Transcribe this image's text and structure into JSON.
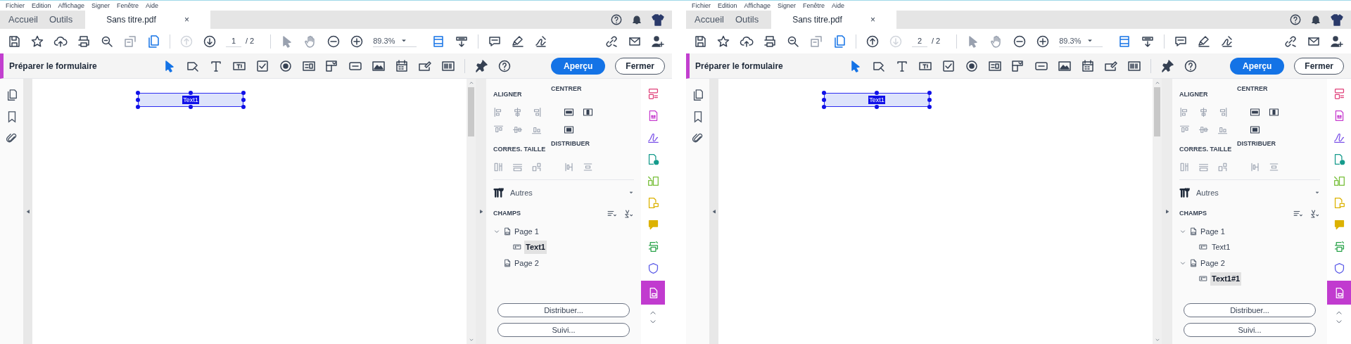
{
  "windows": [
    {
      "menu": [
        "Fichier",
        "Edition",
        "Affichage",
        "Signer",
        "Fenêtre",
        "Aide"
      ],
      "tabs": [
        {
          "label": "Accueil",
          "selected": false
        },
        {
          "label": "Outils",
          "selected": false
        },
        {
          "label": "Sans titre.pdf",
          "selected": true
        }
      ],
      "tab_close": "×",
      "page_nav": {
        "up_disabled": true,
        "down_disabled": false,
        "current": "1",
        "total": "/ 2"
      },
      "zoom": "89.3%",
      "form_bar": {
        "title": "Préparer le formulaire",
        "preview": "Aperçu",
        "close": "Fermer"
      },
      "canvas": {
        "field_label": "Text1"
      },
      "panel": {
        "aligner": "ALIGNER",
        "centrer": "CENTRER",
        "corres": "CORRES. TAILLE",
        "distribuer": "DISTRIBUER",
        "autres": "Autres",
        "champs": "CHAMPS",
        "tree": [
          {
            "label": "Page 1",
            "children": [
              {
                "label": "Text1",
                "selected": true
              }
            ]
          },
          {
            "label": "Page 2"
          }
        ],
        "buttons": [
          "Distribuer...",
          "Suivi..."
        ]
      },
      "rail": [
        {
          "color": "#e0407a",
          "selected": false
        },
        {
          "color": "#c83fcf",
          "selected": false
        },
        {
          "color": "#7b52e8",
          "selected": false
        },
        {
          "color": "#169b8c",
          "selected": false
        },
        {
          "color": "#78bf3a",
          "selected": false
        },
        {
          "color": "#dcb200",
          "selected": false
        },
        {
          "color": "#dcb200",
          "selected": false
        },
        {
          "color": "#2aa34a",
          "selected": false
        },
        {
          "color": "#5a5ae8",
          "selected": false
        },
        {
          "color": "#c13bcf",
          "selected": true
        }
      ]
    },
    {
      "menu": [
        "Fichier",
        "Edition",
        "Affichage",
        "Signer",
        "Fenêtre",
        "Aide"
      ],
      "tabs": [
        {
          "label": "Accueil",
          "selected": false
        },
        {
          "label": "Outils",
          "selected": false
        },
        {
          "label": "Sans titre.pdf",
          "selected": true
        }
      ],
      "tab_close": "×",
      "page_nav": {
        "up_disabled": false,
        "down_disabled": true,
        "current": "2",
        "total": "/ 2"
      },
      "zoom": "89.3%",
      "form_bar": {
        "title": "Préparer le formulaire",
        "preview": "Aperçu",
        "close": "Fermer"
      },
      "canvas": {
        "field_label": "Text1"
      },
      "panel": {
        "aligner": "ALIGNER",
        "centrer": "CENTRER",
        "corres": "CORRES. TAILLE",
        "distribuer": "DISTRIBUER",
        "autres": "Autres",
        "champs": "CHAMPS",
        "tree": [
          {
            "label": "Page 1",
            "children": [
              {
                "label": "Text1",
                "selected": false
              }
            ]
          },
          {
            "label": "Page 2",
            "children": [
              {
                "label": "Text1#1",
                "selected": true
              }
            ]
          }
        ],
        "buttons": [
          "Distribuer...",
          "Suivi..."
        ]
      },
      "rail": [
        {
          "color": "#e0407a",
          "selected": false
        },
        {
          "color": "#c83fcf",
          "selected": false
        },
        {
          "color": "#7b52e8",
          "selected": false
        },
        {
          "color": "#169b8c",
          "selected": false
        },
        {
          "color": "#78bf3a",
          "selected": false
        },
        {
          "color": "#dcb200",
          "selected": false
        },
        {
          "color": "#dcb200",
          "selected": false
        },
        {
          "color": "#2aa34a",
          "selected": false
        },
        {
          "color": "#5a5ae8",
          "selected": false
        },
        {
          "color": "#c13bcf",
          "selected": true
        }
      ]
    }
  ]
}
